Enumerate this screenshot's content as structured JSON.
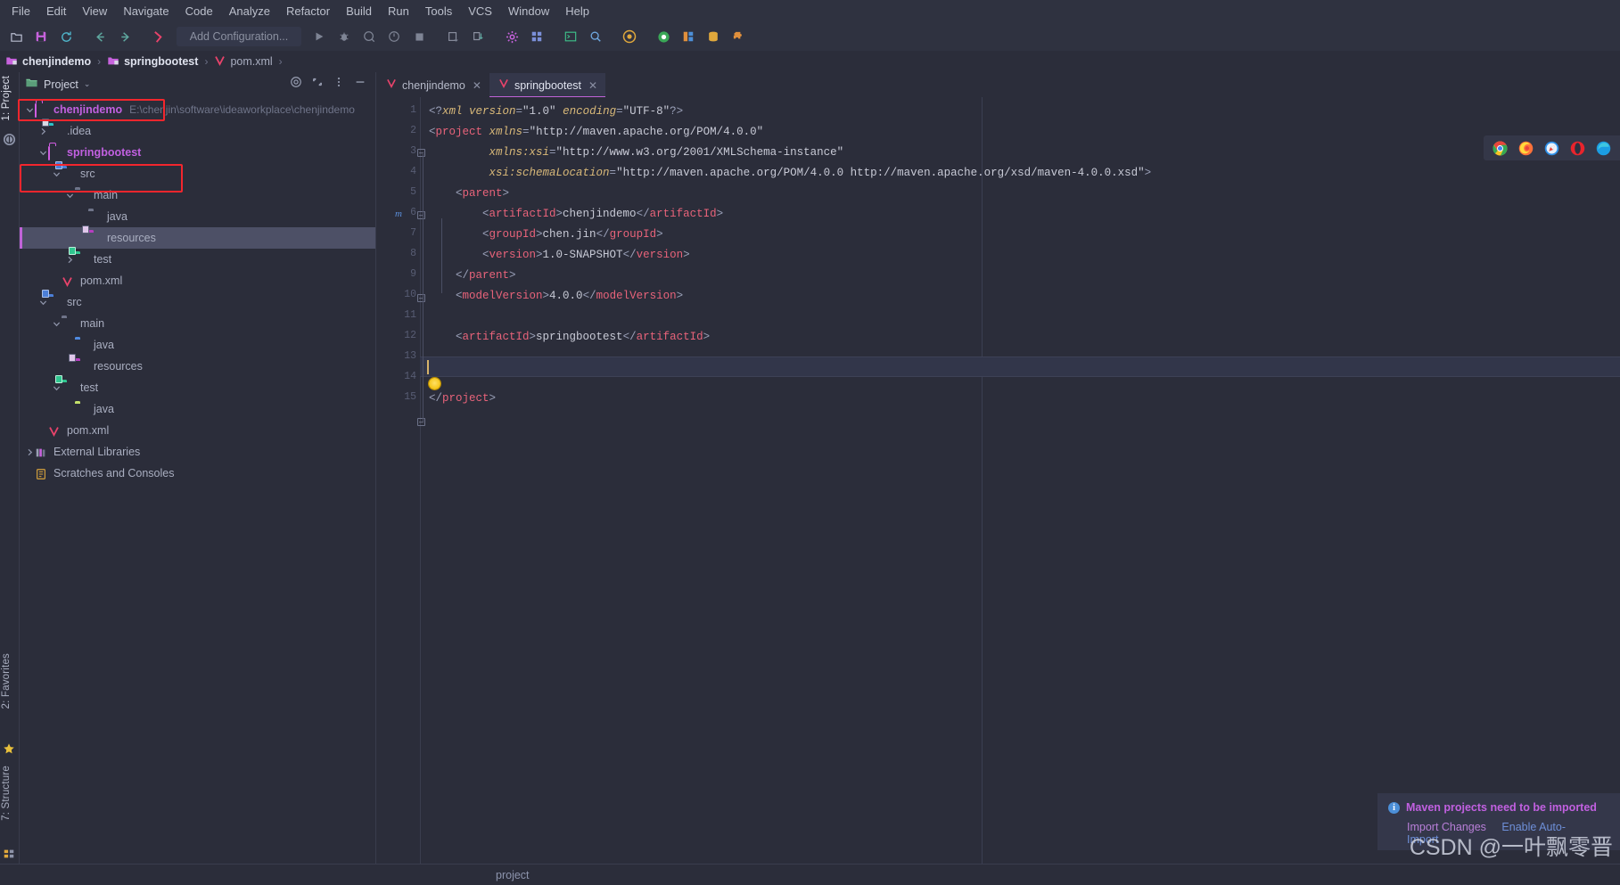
{
  "menu": {
    "items": [
      "File",
      "Edit",
      "View",
      "Navigate",
      "Code",
      "Analyze",
      "Refactor",
      "Build",
      "Run",
      "Tools",
      "VCS",
      "Window",
      "Help"
    ]
  },
  "toolbar": {
    "run_config_placeholder": "Add Configuration...",
    "icons": [
      "open-project-icon",
      "save-all-icon",
      "sync-icon",
      "back-arrow-icon",
      "forward-arrow-icon",
      "maven-run-icon",
      "run-icon",
      "debug-icon",
      "run-with-coverage-icon",
      "profiler-icon",
      "stop-icon",
      "update-project-icon",
      "commit-icon",
      "settings-gear-icon",
      "project-structure-icon",
      "terminal-icon",
      "search-everywhere-icon",
      "maven-icon"
    ]
  },
  "breadcrumb": {
    "items": [
      {
        "label": "chenjindemo",
        "icon": "module-folder-icon",
        "bold": true
      },
      {
        "label": "springbootest",
        "icon": "module-folder-icon",
        "bold": true
      },
      {
        "label": "pom.xml",
        "icon": "maven-v-icon",
        "bold": false
      }
    ],
    "separator": "›"
  },
  "leftbar": {
    "tabs": [
      {
        "label": "1: Project",
        "selected": true
      },
      {
        "label": "2: Favorites",
        "selected": false
      },
      {
        "label": "7: Structure",
        "selected": false
      }
    ],
    "icons": [
      "maven-tool-icon",
      "favorites-star-icon",
      "structure-icon"
    ]
  },
  "project_panel": {
    "title": "Project",
    "chevron": "⌄",
    "actions": [
      "scroll-from-source-icon",
      "collapse-all-icon",
      "more-options-icon",
      "hide-panel-icon"
    ],
    "tree": [
      {
        "depth": 0,
        "label": "chenjindemo",
        "path": "E:\\chenjin\\software\\ideaworkplace\\chenjindemo",
        "icon": "project-folder-icon",
        "arrow": "expanded",
        "highlight": true,
        "boxed": true
      },
      {
        "depth": 1,
        "label": ".idea",
        "icon": "idea-folder-icon",
        "arrow": "collapsed",
        "highlight": false,
        "boxed": false
      },
      {
        "depth": 1,
        "label": "springbootest",
        "icon": "module-folder-icon",
        "arrow": "expanded",
        "highlight": true,
        "boxed": true
      },
      {
        "depth": 2,
        "label": "src",
        "icon": "source-root-icon",
        "arrow": "expanded",
        "highlight": false,
        "boxed": false
      },
      {
        "depth": 3,
        "label": "main",
        "icon": "folder-icon",
        "arrow": "expanded",
        "highlight": false,
        "boxed": false
      },
      {
        "depth": 4,
        "label": "java",
        "icon": "folder-icon",
        "arrow": "none",
        "highlight": false,
        "boxed": false
      },
      {
        "depth": 4,
        "label": "resources",
        "icon": "resources-folder-icon",
        "arrow": "none",
        "highlight": false,
        "boxed": false,
        "selected": true
      },
      {
        "depth": 3,
        "label": "test",
        "icon": "test-source-folder-icon",
        "arrow": "collapsed",
        "highlight": false,
        "boxed": false
      },
      {
        "depth": 2,
        "label": "pom.xml",
        "icon": "maven-v-icon",
        "arrow": "none",
        "highlight": false,
        "boxed": false
      },
      {
        "depth": 1,
        "label": "src",
        "icon": "source-root-icon",
        "arrow": "expanded",
        "highlight": false,
        "boxed": false
      },
      {
        "depth": 2,
        "label": "main",
        "icon": "folder-icon",
        "arrow": "expanded",
        "highlight": false,
        "boxed": false
      },
      {
        "depth": 3,
        "label": "java",
        "icon": "source-folder-blue-icon",
        "arrow": "none",
        "highlight": false,
        "boxed": false
      },
      {
        "depth": 3,
        "label": "resources",
        "icon": "resources-folder-icon",
        "arrow": "none",
        "highlight": false,
        "boxed": false
      },
      {
        "depth": 2,
        "label": "test",
        "icon": "test-source-folder-icon",
        "arrow": "expanded",
        "highlight": false,
        "boxed": false
      },
      {
        "depth": 3,
        "label": "java",
        "icon": "test-folder-green-icon",
        "arrow": "none",
        "highlight": false,
        "boxed": false
      },
      {
        "depth": 1,
        "label": "pom.xml",
        "icon": "maven-v-icon",
        "arrow": "none",
        "highlight": false,
        "boxed": false
      },
      {
        "depth": 0,
        "label": "External Libraries",
        "icon": "libraries-icon",
        "arrow": "collapsed",
        "highlight": false,
        "boxed": false
      },
      {
        "depth": 0,
        "label": "Scratches and Consoles",
        "icon": "scratches-icon",
        "arrow": "none",
        "highlight": false,
        "boxed": false
      }
    ]
  },
  "editor": {
    "tabs": [
      {
        "label": "chenjindemo",
        "icon": "maven-v-icon",
        "active": false,
        "close": "✕"
      },
      {
        "label": "springbootest",
        "icon": "maven-v-icon",
        "active": true,
        "close": "✕"
      }
    ],
    "line_numbers": [
      "1",
      "2",
      "3",
      "4",
      "5",
      "6",
      "7",
      "8",
      "9",
      "10",
      "11",
      "12",
      "13",
      "14",
      "15"
    ],
    "cursor_line": 14,
    "lines": [
      {
        "n": 1,
        "indent": 1,
        "tokens": [
          {
            "t": "punc",
            "v": "<?"
          },
          {
            "t": "attr",
            "v": "xml version"
          },
          {
            "t": "punc",
            "v": "="
          },
          {
            "t": "attrval",
            "v": "\"1.0\""
          },
          {
            "t": "attr",
            "v": " encoding"
          },
          {
            "t": "punc",
            "v": "="
          },
          {
            "t": "attrval",
            "v": "\"UTF-8\""
          },
          {
            "t": "punc",
            "v": "?>"
          }
        ]
      },
      {
        "n": 2,
        "indent": 0,
        "tokens": [
          {
            "t": "punc",
            "v": "<"
          },
          {
            "t": "tag",
            "v": "project"
          },
          {
            "t": "attr",
            "v": " xmlns"
          },
          {
            "t": "punc",
            "v": "="
          },
          {
            "t": "attrval",
            "v": "\"http://maven.apache.org/POM/4.0.0\""
          }
        ]
      },
      {
        "n": 3,
        "indent": 0,
        "tokens": [
          {
            "t": "attr",
            "v": "         xmlns:xsi"
          },
          {
            "t": "punc",
            "v": "="
          },
          {
            "t": "attrval",
            "v": "\"http://www.w3.org/2001/XMLSchema-instance\""
          }
        ]
      },
      {
        "n": 4,
        "indent": 0,
        "tokens": [
          {
            "t": "attr",
            "v": "         xsi:schemaLocation"
          },
          {
            "t": "punc",
            "v": "="
          },
          {
            "t": "attrval",
            "v": "\"http://maven.apache.org/POM/4.0.0 http://maven.apache.org/xsd/maven-4.0.0.xsd\""
          },
          {
            "t": "punc",
            "v": ">"
          }
        ]
      },
      {
        "n": 5,
        "indent": 0,
        "tokens": [
          {
            "t": "punc",
            "v": "    <"
          },
          {
            "t": "tag",
            "v": "parent"
          },
          {
            "t": "punc",
            "v": ">"
          }
        ]
      },
      {
        "n": 6,
        "indent": 0,
        "tokens": [
          {
            "t": "punc",
            "v": "        <"
          },
          {
            "t": "tag",
            "v": "artifactId"
          },
          {
            "t": "punc",
            "v": ">"
          },
          {
            "t": "txt",
            "v": "chenjindemo"
          },
          {
            "t": "punc",
            "v": "</"
          },
          {
            "t": "tag",
            "v": "artifactId"
          },
          {
            "t": "punc",
            "v": ">"
          }
        ]
      },
      {
        "n": 7,
        "indent": 0,
        "tokens": [
          {
            "t": "punc",
            "v": "        <"
          },
          {
            "t": "tag",
            "v": "groupId"
          },
          {
            "t": "punc",
            "v": ">"
          },
          {
            "t": "txt",
            "v": "chen.jin"
          },
          {
            "t": "punc",
            "v": "</"
          },
          {
            "t": "tag",
            "v": "groupId"
          },
          {
            "t": "punc",
            "v": ">"
          }
        ]
      },
      {
        "n": 8,
        "indent": 0,
        "tokens": [
          {
            "t": "punc",
            "v": "        <"
          },
          {
            "t": "tag",
            "v": "version"
          },
          {
            "t": "punc",
            "v": ">"
          },
          {
            "t": "txt",
            "v": "1.0-SNAPSHOT"
          },
          {
            "t": "punc",
            "v": "</"
          },
          {
            "t": "tag",
            "v": "version"
          },
          {
            "t": "punc",
            "v": ">"
          }
        ]
      },
      {
        "n": 9,
        "indent": 0,
        "tokens": [
          {
            "t": "punc",
            "v": "    </"
          },
          {
            "t": "tag",
            "v": "parent"
          },
          {
            "t": "punc",
            "v": ">"
          }
        ]
      },
      {
        "n": 10,
        "indent": 0,
        "tokens": [
          {
            "t": "punc",
            "v": "    <"
          },
          {
            "t": "tag",
            "v": "modelVersion"
          },
          {
            "t": "punc",
            "v": ">"
          },
          {
            "t": "txt",
            "v": "4.0.0"
          },
          {
            "t": "punc",
            "v": "</"
          },
          {
            "t": "tag",
            "v": "modelVersion"
          },
          {
            "t": "punc",
            "v": ">"
          }
        ]
      },
      {
        "n": 11,
        "indent": 0,
        "tokens": []
      },
      {
        "n": 12,
        "indent": 0,
        "tokens": [
          {
            "t": "punc",
            "v": "    <"
          },
          {
            "t": "tag",
            "v": "artifactId"
          },
          {
            "t": "punc",
            "v": ">"
          },
          {
            "t": "txt",
            "v": "springbootest"
          },
          {
            "t": "punc",
            "v": "</"
          },
          {
            "t": "tag",
            "v": "artifactId"
          },
          {
            "t": "punc",
            "v": ">"
          }
        ]
      },
      {
        "n": 13,
        "indent": 0,
        "tokens": []
      },
      {
        "n": 14,
        "indent": 0,
        "tokens": []
      },
      {
        "n": 15,
        "indent": 0,
        "tokens": [
          {
            "t": "punc",
            "v": "</"
          },
          {
            "t": "tag",
            "v": "project"
          },
          {
            "t": "punc",
            "v": ">"
          }
        ]
      }
    ]
  },
  "browsers": {
    "items": [
      "chrome-icon",
      "firefox-icon",
      "safari-icon",
      "opera-icon",
      "edge-icon"
    ]
  },
  "notification": {
    "title": "Maven projects need to be imported",
    "info_icon": "info-icon",
    "links": [
      {
        "label": "Import Changes",
        "style": "purple"
      },
      {
        "label": "Enable Auto-Import",
        "style": "blue"
      }
    ]
  },
  "watermark": {
    "text": "CSDN @一叶飘零晋"
  },
  "statusbar": {
    "breadcrumb": "project"
  },
  "colors": {
    "accent_purple": "#c063d8",
    "highlight_red": "#f3262d",
    "tag_pink": "#e8637a",
    "attr_yellow": "#d9b979",
    "bg": "#2b2d3a",
    "selection": "#4d5066"
  }
}
